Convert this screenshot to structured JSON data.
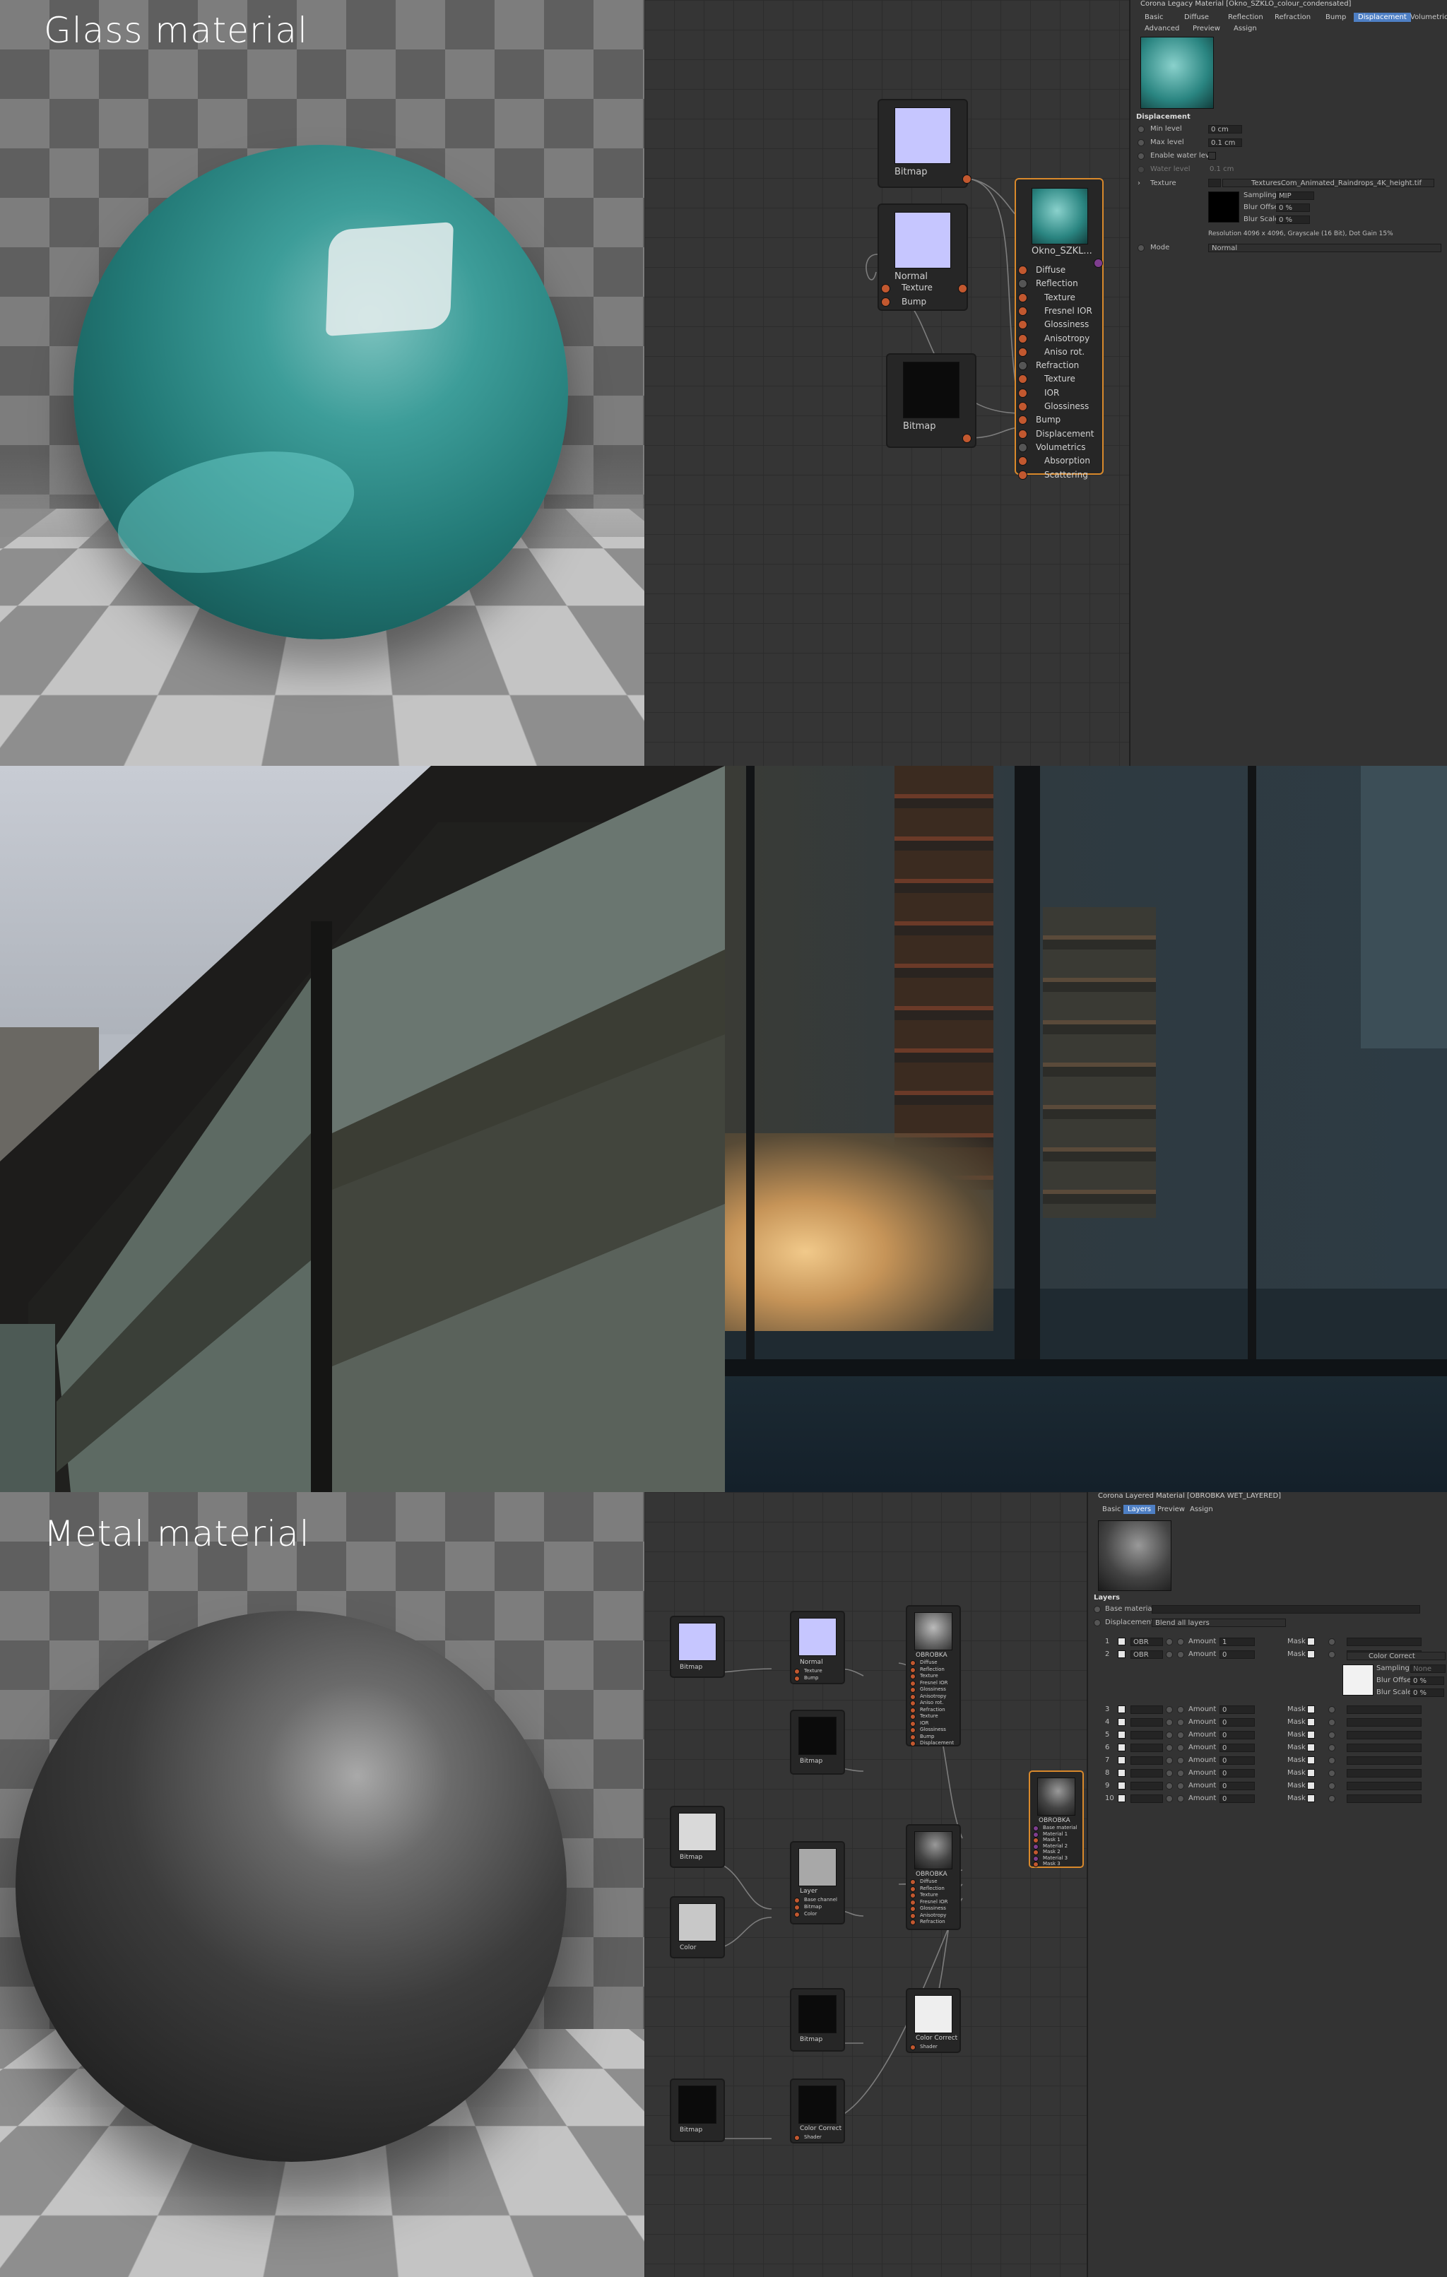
{
  "glass_panel": {
    "title": "Glass material"
  },
  "metal_panel": {
    "title": "Metal material"
  },
  "glass_nodes": {
    "bitmap_top": {
      "label": "Bitmap"
    },
    "normal": {
      "label": "Normal",
      "ports": [
        "Texture",
        "Bump"
      ]
    },
    "bitmap_bottom": {
      "label": "Bitmap"
    },
    "material": {
      "label": "Okno_SZKL...",
      "ports": [
        "Diffuse",
        "Reflection",
        "Texture",
        "Fresnel IOR",
        "Glossiness",
        "Anisotropy",
        "Aniso rot.",
        "Refraction",
        "Texture",
        "IOR",
        "Glossiness",
        "Bump",
        "Displacement",
        "Volumetrics",
        "Absorption",
        "Scattering"
      ]
    }
  },
  "glass_attr": {
    "title": "Corona Legacy Material [Okno_SZKLO_colour_condensated]",
    "tabs": [
      "Basic",
      "Diffuse",
      "Reflection",
      "Refraction",
      "Bump",
      "Displacement",
      "Volumetrics"
    ],
    "tabs2": [
      "Advanced",
      "Preview",
      "Assign"
    ],
    "active_tab": "Displacement",
    "section": "Displacement",
    "min_level_label": "Min level",
    "min_level_value": "0 cm",
    "max_level_label": "Max level",
    "max_level_value": "0.1 cm",
    "enable_water_label": "Enable water level",
    "water_level_label": "Water level",
    "water_level_value": "0.1 cm",
    "texture_label": "Texture",
    "texture_value": "TexturesCom_Animated_Raindrops_4K_height.tif",
    "sampling_label": "Sampling",
    "sampling_value": "MIP",
    "blur_offset_label": "Blur Offset",
    "blur_offset_value": "0 %",
    "blur_scale_label": "Blur Scale",
    "blur_scale_value": "0 %",
    "resolution_text": "Resolution 4096 x 4096, Grayscale (16 Bit), Dot Gain 15%",
    "mode_label": "Mode",
    "mode_value": "Normal"
  },
  "metal_nodes": {
    "bitmap1": "Bitmap",
    "normal": "Normal",
    "normal_ports": [
      "Texture",
      "Bump"
    ],
    "mat1": "OBROBKA",
    "mat1_ports": [
      "Diffuse",
      "Reflection",
      "Texture",
      "Fresnel IOR",
      "Glossiness",
      "Anisotropy",
      "Aniso rot.",
      "Refraction",
      "Texture",
      "IOR",
      "Glossiness",
      "Bump",
      "Displacement"
    ],
    "bitmap2": "Bitmap",
    "bitmap3": "Bitmap",
    "color": "Color",
    "layer": "Layer",
    "layer_ports": [
      "Base channel",
      "Bitmap",
      "Color"
    ],
    "mat2": "OBROBKA",
    "mat2_ports": [
      "Diffuse",
      "Reflection",
      "Texture",
      "Fresnel IOR",
      "Glossiness",
      "Anisotropy",
      "Refraction"
    ],
    "layered": "OBROBKA",
    "layered_ports": [
      "Base material",
      "Material 1",
      "Mask 1",
      "Material 2",
      "Mask 2",
      "Material 3",
      "Mask 3"
    ],
    "bitmap4": "Bitmap",
    "color_correct1": "Color Correct",
    "color_correct1_port": "Shader",
    "bitmap5": "Bitmap",
    "color_correct2": "Color Correct",
    "color_correct2_port": "Shader"
  },
  "metal_attr": {
    "title": "Corona Layered Material [OBROBKA WET_LAYERED]",
    "tabs": [
      "Basic",
      "Layers",
      "Preview",
      "Assign"
    ],
    "active_tab": "Layers",
    "section": "Layers",
    "base_material_label": "Base material",
    "displacement_label": "Displacement",
    "displacement_value": "Blend all layers",
    "layer_rows": [
      {
        "num": "1",
        "mat": "OBR",
        "amount_label": "Amount",
        "amount": "1",
        "mask_label": "Mask"
      },
      {
        "num": "2",
        "mat": "OBR",
        "amount_label": "Amount",
        "amount": "0",
        "mask_label": "Mask"
      },
      {
        "num": "3",
        "mat": "",
        "amount_label": "Amount",
        "amount": "0",
        "mask_label": "Mask"
      },
      {
        "num": "4",
        "mat": "",
        "amount_label": "Amount",
        "amount": "0",
        "mask_label": "Mask"
      },
      {
        "num": "5",
        "mat": "",
        "amount_label": "Amount",
        "amount": "0",
        "mask_label": "Mask"
      },
      {
        "num": "6",
        "mat": "",
        "amount_label": "Amount",
        "amount": "0",
        "mask_label": "Mask"
      },
      {
        "num": "7",
        "mat": "",
        "amount_label": "Amount",
        "amount": "0",
        "mask_label": "Mask"
      },
      {
        "num": "8",
        "mat": "",
        "amount_label": "Amount",
        "amount": "0",
        "mask_label": "Mask"
      },
      {
        "num": "9",
        "mat": "",
        "amount_label": "Amount",
        "amount": "0",
        "mask_label": "Mask"
      },
      {
        "num": "10",
        "mat": "",
        "amount_label": "Amount",
        "amount": "0",
        "mask_label": "Mask"
      }
    ],
    "color_correct_label": "Color Correct",
    "sampling_label": "Sampling",
    "sampling_value": "None",
    "blur_offset_label": "Blur Offset",
    "blur_offset_value": "0 %",
    "blur_scale_label": "Blur Scale",
    "blur_scale_value": "0 %"
  },
  "colors": {
    "glass_teal": "#2e8f8c",
    "socket": "#c2582f",
    "accent_tab": "#4e7fc4",
    "selected_node": "#d9892b"
  }
}
